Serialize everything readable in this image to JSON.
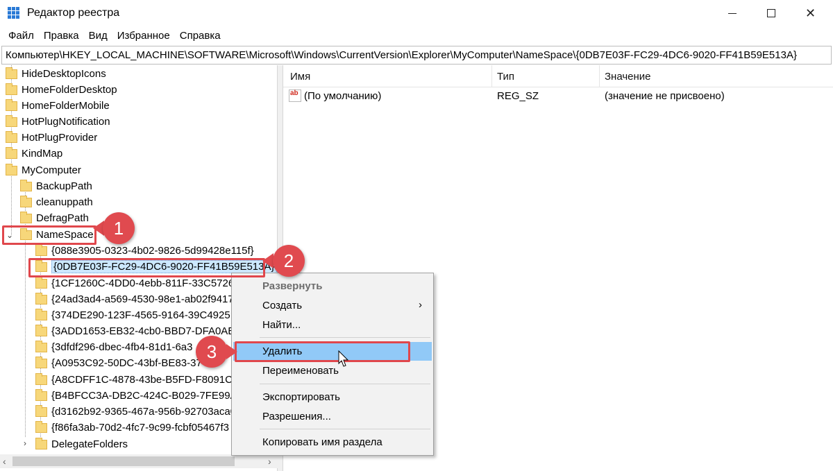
{
  "window": {
    "title": "Редактор реестра"
  },
  "menu": [
    "Файл",
    "Правка",
    "Вид",
    "Избранное",
    "Справка"
  ],
  "address": "Компьютер\\HKEY_LOCAL_MACHINE\\SOFTWARE\\Microsoft\\Windows\\CurrentVersion\\Explorer\\MyComputer\\NameSpace\\{0DB7E03F-FC29-4DC6-9020-FF41B59E513A}",
  "tree": {
    "top_items": [
      "HideDesktopIcons",
      "HomeFolderDesktop",
      "HomeFolderMobile",
      "HotPlugNotification",
      "HotPlugProvider",
      "KindMap",
      "MyComputer"
    ],
    "mycomputer_children": [
      "BackupPath",
      "cleanuppath",
      "DefragPath",
      "NameSpace"
    ],
    "namespace_children": [
      "{088e3905-0323-4b02-9826-5d99428e115f}",
      "{0DB7E03F-FC29-4DC6-9020-FF41B59E513A}",
      "{1CF1260C-4DD0-4ebb-811F-33C5726",
      "{24ad3ad4-a569-4530-98e1-ab02f9417",
      "{374DE290-123F-4565-9164-39C4925E4",
      "{3ADD1653-EB32-4cb0-BBD7-DFA0AB",
      "{3dfdf296-dbec-4fb4-81d1-6a3",
      "{A0953C92-50DC-43bf-BE83-37",
      "{A8CDFF1C-4878-43be-B5FD-F8091C1",
      "{B4BFCC3A-DB2C-424C-B029-7FE99A",
      "{d3162b92-9365-467a-956b-92703aca0",
      "{f86fa3ab-70d2-4fc7-9c99-fcbf05467f3"
    ],
    "after_item": "DelegateFolders"
  },
  "values": {
    "headers": {
      "name": "Имя",
      "type": "Тип",
      "value": "Значение"
    },
    "rows": [
      {
        "name": "(По умолчанию)",
        "type": "REG_SZ",
        "value": "(значение не присвоено)",
        "icon_text": "ab"
      }
    ]
  },
  "context_menu": {
    "expand": "Развернуть",
    "create": "Создать",
    "find": "Найти...",
    "delete": "Удалить",
    "rename": "Переименовать",
    "export": "Экспортировать",
    "permissions": "Разрешения...",
    "copy_key_name": "Копировать имя раздела"
  },
  "annotations": {
    "step1": "1",
    "step2": "2",
    "step3": "3",
    "highlight_color": "#e0474c"
  },
  "colors": {
    "folder": "#f7d77a",
    "menu_hover": "#91c9f7",
    "selection": "#cce8ff"
  }
}
